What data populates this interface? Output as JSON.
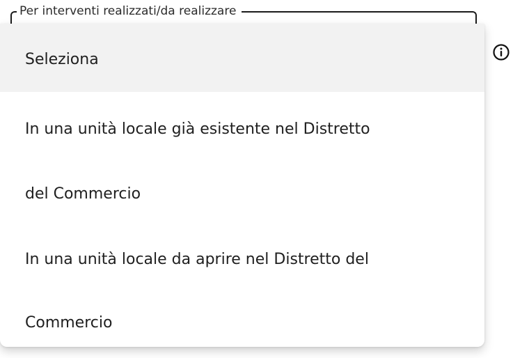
{
  "field": {
    "label": "Per interventi realizzati/da realizzare"
  },
  "dropdown": {
    "options": [
      {
        "label": "Seleziona",
        "selected": true
      },
      {
        "label_line1": "In una unità locale già esistente nel Distretto",
        "label_line2": "del Commercio"
      },
      {
        "label_line1": "In una unità locale da aprire nel Distretto del",
        "label_line2": "Commercio"
      }
    ]
  },
  "icons": {
    "info": "info-circle-icon"
  }
}
